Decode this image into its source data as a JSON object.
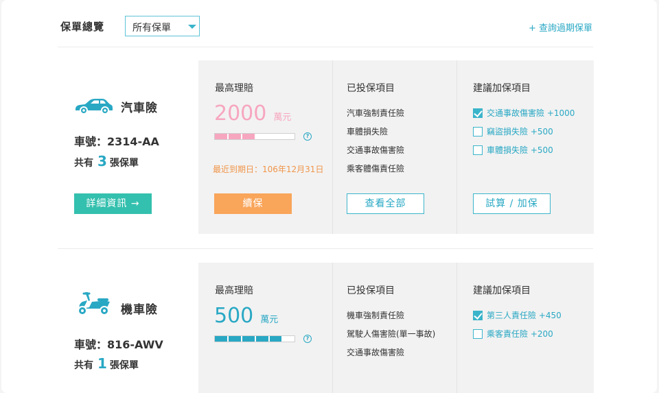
{
  "header": {
    "title": "保單總覽",
    "filter_value": "所有保單",
    "past_link": "+ 查詢過期保單"
  },
  "colors": {
    "accent": "#29a8c4",
    "pink": "#f7a6bf",
    "orange": "#f9a55a",
    "teal_button": "#34c0ae"
  },
  "policies": [
    {
      "icon": "car-icon",
      "name": "汽車險",
      "plate_label": "車號：2314-AA",
      "count_prefix": "共有",
      "count": "3",
      "count_suffix": "張保單",
      "detail_button": "詳細資訊 →",
      "max_claim_label": "最高理賠",
      "max_claim_value": "2000",
      "max_claim_unit": "萬元",
      "claim_progress_percent": 50,
      "expire_text": "最近到期日：106年12月31日",
      "renew_button": "續保",
      "covered_label": "已投保項目",
      "covered_items": [
        "汽車強制責任險",
        "車體損失險",
        "交通事故傷害險",
        "乘客體傷責任險"
      ],
      "view_all_button": "查看全部",
      "suggest_label": "建議加保項目",
      "suggestions": [
        {
          "label": "交通事故傷害險 +1000",
          "checked": true
        },
        {
          "label": "竊盜損失險 +500",
          "checked": false
        },
        {
          "label": "車體損失險 +500",
          "checked": false
        }
      ],
      "calc_button": "試算 / 加保"
    },
    {
      "icon": "scooter-icon",
      "name": "機車險",
      "plate_label": "車號：816-AWV",
      "count_prefix": "共有",
      "count": "1",
      "count_suffix": "張保單",
      "max_claim_label": "最高理賠",
      "max_claim_value": "500",
      "max_claim_unit": "萬元",
      "claim_progress_percent": 84,
      "covered_label": "已投保項目",
      "covered_items": [
        "機車強制責任險",
        "駕駛人傷害險(單一事故)",
        "交通事故傷害險"
      ],
      "suggest_label": "建議加保項目",
      "suggestions": [
        {
          "label": "第三人責任險 +450",
          "checked": true
        },
        {
          "label": "乘客責任險 +200",
          "checked": false
        }
      ]
    }
  ]
}
